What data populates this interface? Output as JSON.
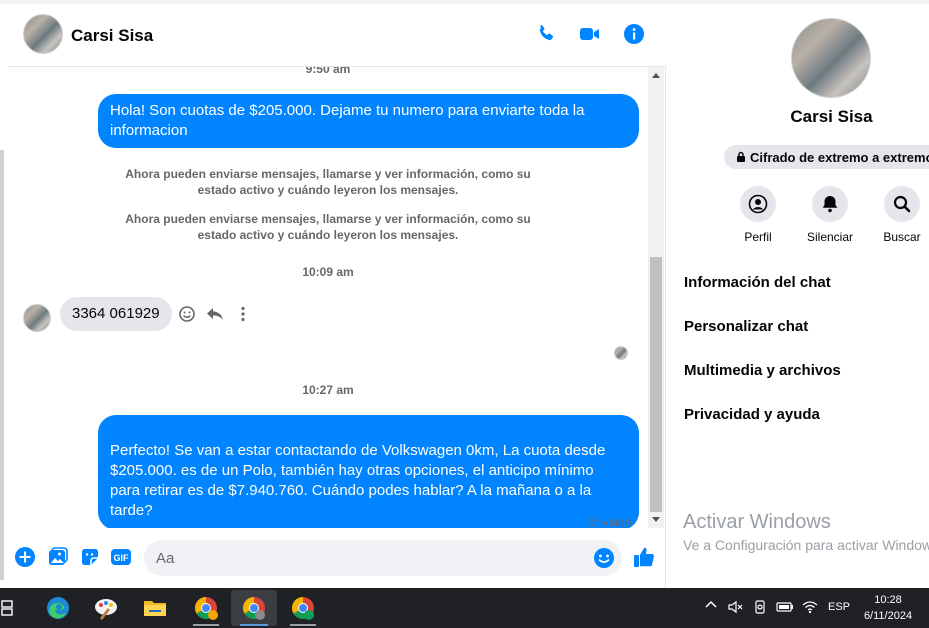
{
  "colors": {
    "accent": "#0084ff",
    "bubble_in": "#e4e6eb",
    "taskbar": "#1f2125"
  },
  "chat": {
    "contact_name": "Carsi Sisa",
    "header_icons": [
      "phone-icon",
      "video-icon",
      "info-icon"
    ],
    "messages": [
      {
        "type": "time",
        "text": "9:50 am"
      },
      {
        "type": "outgoing",
        "text": "Hola! Son cuotas de $205.000. Dejame tu numero para enviarte toda la informacion"
      },
      {
        "type": "system",
        "text": "Ahora pueden enviarse mensajes, llamarse y ver información, como su estado activo y cuándo leyeron los mensajes."
      },
      {
        "type": "system",
        "text": "Ahora pueden enviarse mensajes, llamarse y ver información, como su estado activo y cuándo leyeron los mensajes."
      },
      {
        "type": "time",
        "text": "10:09 am"
      },
      {
        "type": "incoming",
        "text": "3364 061929"
      },
      {
        "type": "time",
        "text": "10:27 am"
      },
      {
        "type": "outgoing",
        "text": "Perfecto!  Se van a estar contactando de Volkswagen 0km, La cuota desde $205.000. es de un Polo, también hay otras opciones, el anticipo mínimo para retirar es de $7.940.760. Cuándo podes hablar? A la mañana o a la tarde?"
      }
    ],
    "status": "Enviado",
    "composer": {
      "placeholder": "Aa"
    }
  },
  "info": {
    "name": "Carsi Sisa",
    "e2e": "Cifrado de extremo a extremo",
    "actions": [
      {
        "label": "Perfil",
        "icon": "profile-icon"
      },
      {
        "label": "Silenciar",
        "icon": "bell-icon"
      },
      {
        "label": "Buscar",
        "icon": "search-icon"
      }
    ],
    "items": [
      "Información del chat",
      "Personalizar chat",
      "Multimedia y archivos",
      "Privacidad y ayuda"
    ],
    "watermark_title": "Activar Windows",
    "watermark_sub": "Ve a Configuración para activar Windows."
  },
  "taskbar": {
    "lang": "ESP",
    "time": "10:28",
    "date": "6/11/2024"
  }
}
